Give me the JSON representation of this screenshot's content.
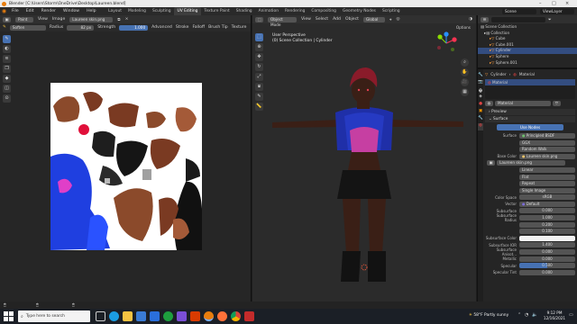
{
  "window": {
    "title": "Blender [C:\\Users\\Storm\\OneDrive\\Desktop\\Laureen.blend]"
  },
  "menubar": {
    "items": [
      "File",
      "Edit",
      "Render",
      "Window",
      "Help"
    ],
    "workspaces": [
      "Layout",
      "Modeling",
      "Sculpting",
      "UV Editing",
      "Texture Paint",
      "Shading",
      "Animation",
      "Rendering",
      "Compositing",
      "Geometry Nodes",
      "Scripting"
    ],
    "active_workspace": "UV Editing",
    "scene": "Scene",
    "view_layer": "ViewLayer"
  },
  "image_editor": {
    "header": {
      "mode": "Paint",
      "view": "View",
      "image": "Image",
      "image_name": "Laureen skin.png"
    },
    "tool_header": {
      "brush": "Soften",
      "radius_label": "Radius",
      "radius_value": "82 px",
      "strength_label": "Strength",
      "strength_value": "1.000",
      "advanced": "Advanced",
      "stroke": "Stroke",
      "falloff": "Falloff",
      "brush_tip": "Brush Tip",
      "texture": "Texture"
    }
  },
  "viewport": {
    "header": {
      "mode": "Object Mode",
      "view": "View",
      "select": "Select",
      "add": "Add",
      "object": "Object",
      "orientation": "Global",
      "options": "Options"
    },
    "overlay_title": "User Perspective",
    "overlay_subtitle": "(0) Scene Collection | Cylinder"
  },
  "outliner": {
    "title": "Scene Collection",
    "items": [
      {
        "name": "Collection"
      },
      {
        "name": "Cube"
      },
      {
        "name": "Cube.001"
      },
      {
        "name": "Cylinder"
      },
      {
        "name": "Sphere"
      },
      {
        "name": "Sphere.001"
      }
    ]
  },
  "properties": {
    "breadcrumb_obj": "Cylinder",
    "breadcrumb_mat": "Material",
    "slot": "Material",
    "material_name": "Material",
    "preview": "Preview",
    "surface_section": "Surface",
    "use_nodes": "Use Nodes",
    "surface_label": "Surface",
    "surface_value": "Principled BSDF",
    "distribution": "GGX",
    "subsurface_method": "Random Walk",
    "base_color_label": "Base Color",
    "base_color_value": "Laureen skin.png",
    "image_name": "Laureen skin.png",
    "interp": "Linear",
    "projection": "Flat",
    "extension": "Repeat",
    "source": "Single Image",
    "color_space_label": "Color Space",
    "color_space_value": "sRGB",
    "vector_label": "Vector",
    "vector_value": "Default",
    "rows": [
      {
        "label": "Subsurface",
        "value": "0.000"
      },
      {
        "label": "Subsurface Radius",
        "value": "1.000"
      },
      {
        "label": "",
        "value": "0.200"
      },
      {
        "label": "",
        "value": "0.100"
      },
      {
        "label": "Subsurface Color",
        "value": ""
      },
      {
        "label": "Subsurface IOR",
        "value": "1.400"
      },
      {
        "label": "Subsurface Anisot...",
        "value": "0.000"
      },
      {
        "label": "Metallic",
        "value": "0.000"
      },
      {
        "label": "Specular",
        "value": "0.500"
      },
      {
        "label": "Specular Tint",
        "value": "0.000"
      }
    ]
  },
  "taskbar": {
    "search_placeholder": "Type here to search",
    "weather": "58°F  Partly sunny",
    "time": "9:12 PM",
    "date": "12/16/2021"
  },
  "colors": {
    "accent": "#4772b3",
    "viewport_bg": "#2b2b2b",
    "panel_bg": "#252525"
  }
}
